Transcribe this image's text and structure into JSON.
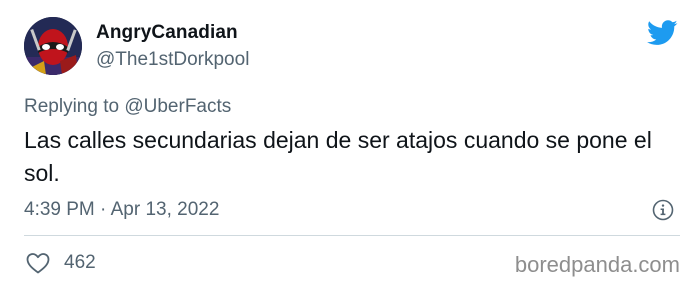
{
  "user": {
    "display_name": "AngryCanadian",
    "handle": "@The1stDorkpool",
    "avatar_icon": "deadpool-avatar"
  },
  "reply": {
    "prefix": "Replying to",
    "mention": "@UberFacts"
  },
  "tweet": {
    "text": "Las calles secundarias dejan de ser atajos cuando se pone el sol.",
    "timestamp": "4:39 PM · Apr 13, 2022"
  },
  "actions": {
    "likes": "462"
  },
  "watermark": "boredpanda.com",
  "colors": {
    "twitter_blue": "#1d9bf0",
    "text_primary": "#0f1419",
    "text_secondary": "#536471",
    "divider": "#cfd9de"
  }
}
